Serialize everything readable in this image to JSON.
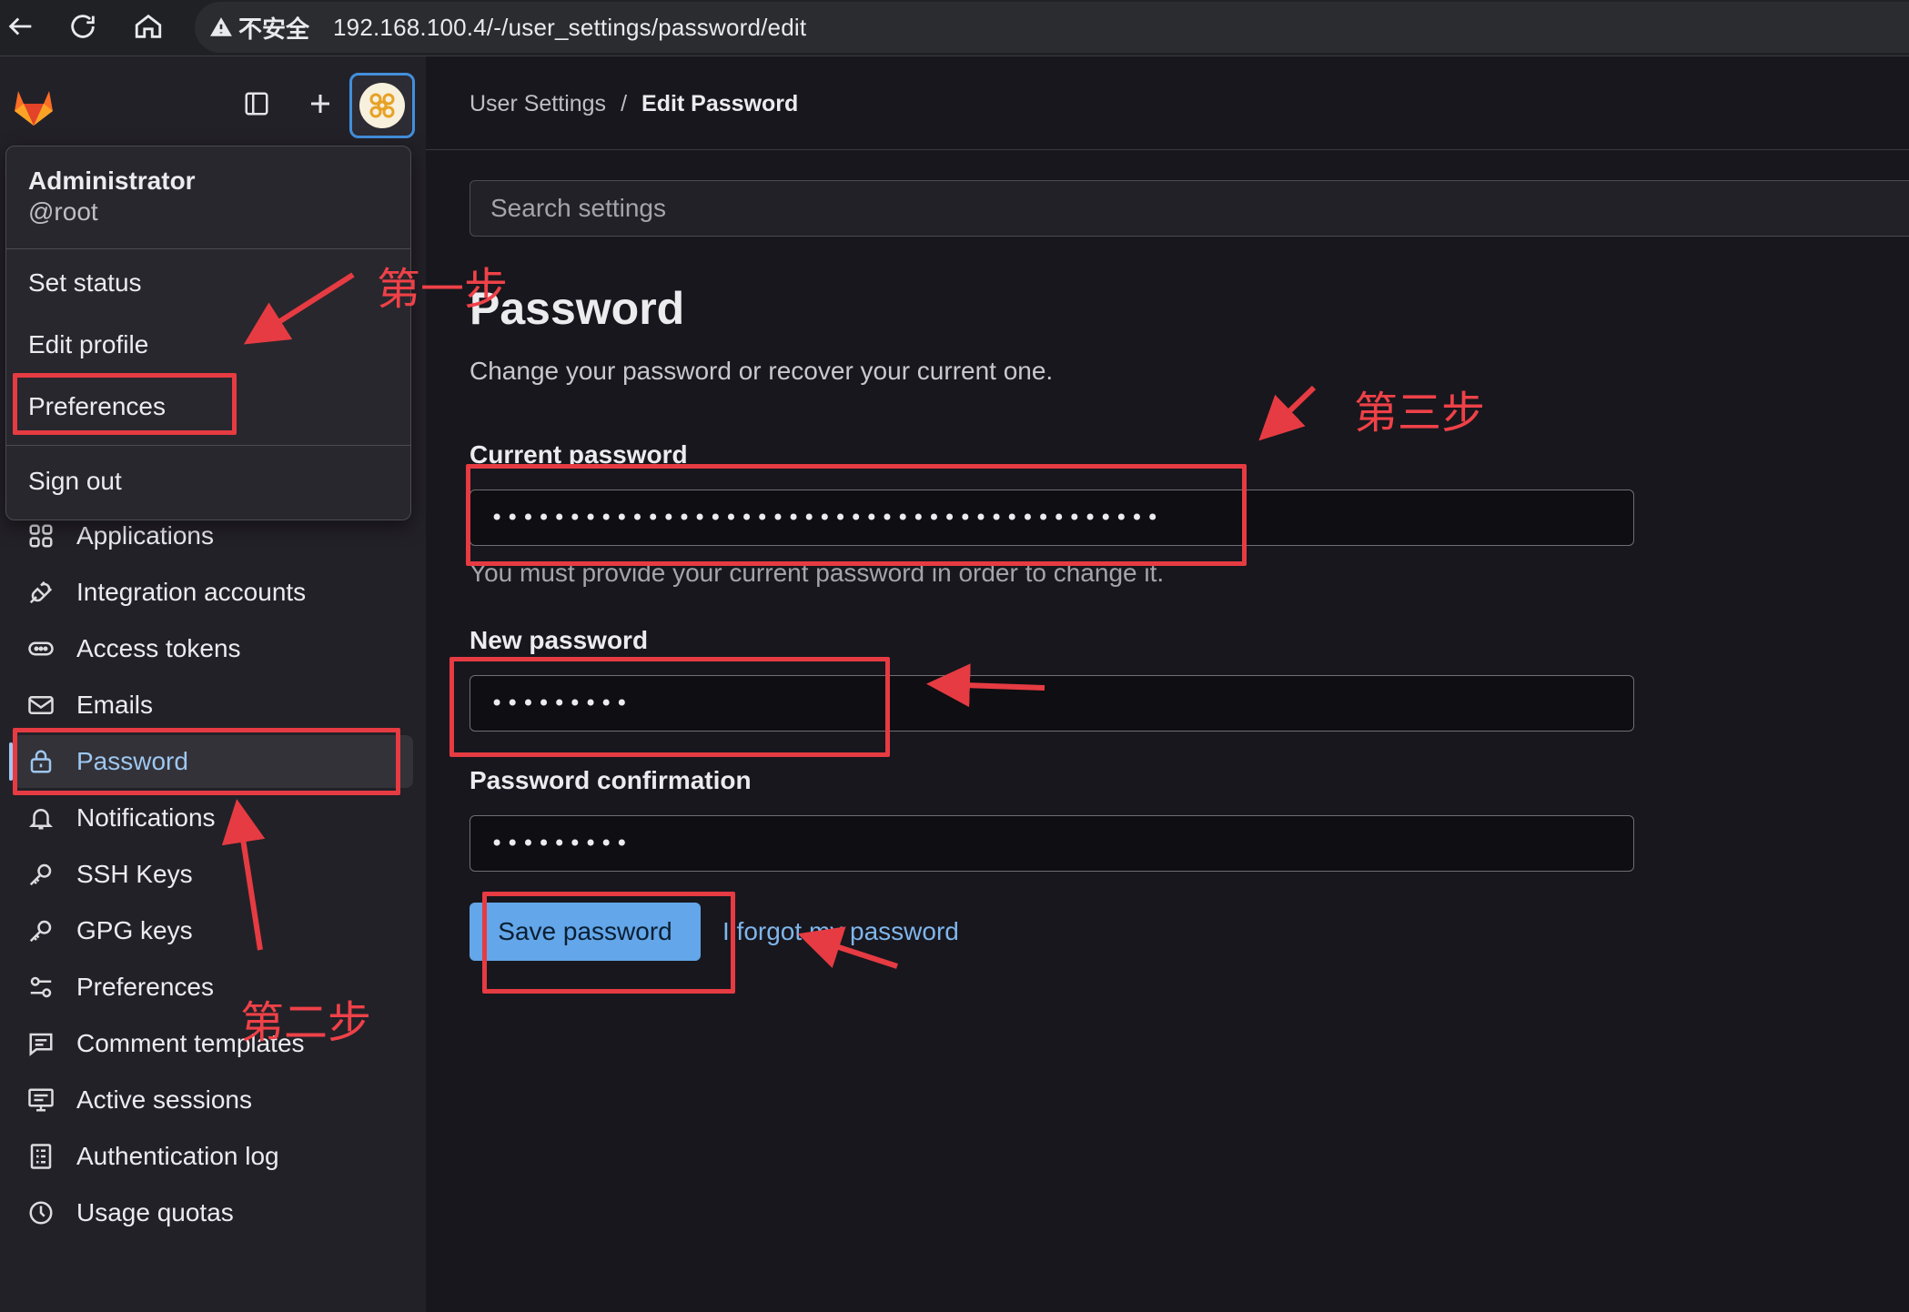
{
  "browser": {
    "security_warning": "不安全",
    "url": "192.168.100.4/-/user_settings/password/edit"
  },
  "sidebar": {
    "items": [
      {
        "label": "Applications",
        "icon": "applications-icon"
      },
      {
        "label": "Integration accounts",
        "icon": "plug-icon"
      },
      {
        "label": "Access tokens",
        "icon": "token-icon"
      },
      {
        "label": "Emails",
        "icon": "mail-icon"
      },
      {
        "label": "Password",
        "icon": "lock-icon",
        "active": true
      },
      {
        "label": "Notifications",
        "icon": "bell-icon"
      },
      {
        "label": "SSH Keys",
        "icon": "key-icon"
      },
      {
        "label": "GPG keys",
        "icon": "key-icon"
      },
      {
        "label": "Preferences",
        "icon": "preferences-icon"
      },
      {
        "label": "Comment templates",
        "icon": "comment-icon"
      },
      {
        "label": "Active sessions",
        "icon": "monitor-icon"
      },
      {
        "label": "Authentication log",
        "icon": "log-icon"
      },
      {
        "label": "Usage quotas",
        "icon": "quota-icon"
      }
    ]
  },
  "user_menu": {
    "name": "Administrator",
    "username": "@root",
    "items": {
      "set_status": "Set status",
      "edit_profile": "Edit profile",
      "preferences": "Preferences",
      "sign_out": "Sign out"
    }
  },
  "breadcrumb": {
    "parent": "User Settings",
    "separator": "/",
    "current": "Edit Password"
  },
  "search": {
    "placeholder": "Search settings"
  },
  "page": {
    "title": "Password",
    "description": "Change your password or recover your current one."
  },
  "form": {
    "current_password_label": "Current password",
    "current_password_value": "•••••••••••••••••••••••••••••••••••••••••••",
    "current_password_help": "You must provide your current password in order to change it.",
    "new_password_label": "New password",
    "new_password_value": "•••••••••",
    "confirm_label": "Password confirmation",
    "confirm_value": "•••••••••",
    "save_label": "Save password",
    "forgot_label": "I forgot my password"
  },
  "annotations": {
    "step1": "第一步",
    "step2": "第二步",
    "step3": "第三步",
    "color": "#e63b42"
  },
  "colors": {
    "accent": "#63a6e9",
    "active_nav": "#9dc7f1",
    "background": "#18171d",
    "sidebar": "#232128"
  }
}
